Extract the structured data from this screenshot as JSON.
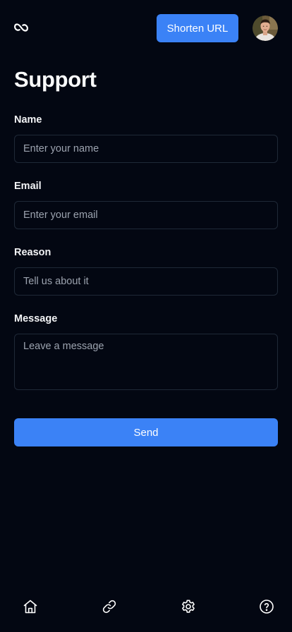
{
  "header": {
    "logo_icon": "infinity-link-icon",
    "shorten_button_label": "Shorten URL",
    "avatar_icon": "user-avatar"
  },
  "page": {
    "title": "Support"
  },
  "form": {
    "name": {
      "label": "Name",
      "placeholder": "Enter your name",
      "value": ""
    },
    "email": {
      "label": "Email",
      "placeholder": "Enter your email",
      "value": ""
    },
    "reason": {
      "label": "Reason",
      "placeholder": "Tell us about it",
      "value": ""
    },
    "message": {
      "label": "Message",
      "placeholder": "Leave a message",
      "value": ""
    },
    "submit_label": "Send"
  },
  "bottom_nav": {
    "items": [
      {
        "icon": "home-icon"
      },
      {
        "icon": "link-icon"
      },
      {
        "icon": "gear-icon"
      },
      {
        "icon": "help-circle-icon"
      }
    ]
  },
  "colors": {
    "background": "#030712",
    "accent": "#3b82f6",
    "border": "#1f2937",
    "text": "#f9fafb",
    "placeholder": "#9ca3af"
  }
}
